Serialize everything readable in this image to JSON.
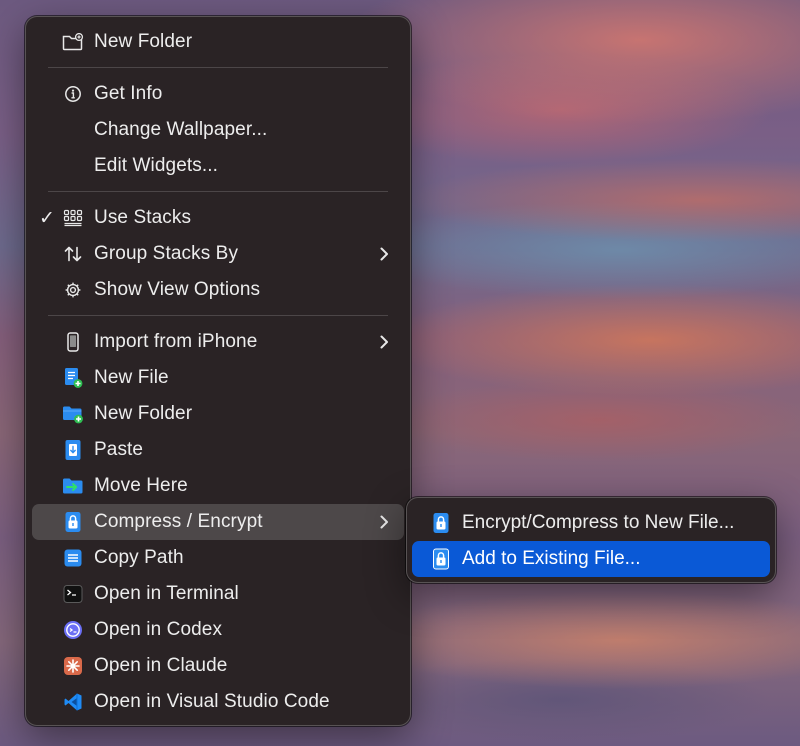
{
  "colors": {
    "menu_bg": "#2a2325",
    "hover_bg": "#4d4849",
    "selected_bg": "#0a59d6",
    "text": "#ededed",
    "icon_blue": "#1f8bf5"
  },
  "menu": {
    "groups": [
      [
        {
          "label": "New Folder",
          "icon": "folder-badge-plus-icon"
        }
      ],
      [
        {
          "label": "Get Info",
          "icon": "info-circle-icon"
        },
        {
          "label": "Change Wallpaper..."
        },
        {
          "label": "Edit Widgets..."
        }
      ],
      [
        {
          "label": "Use Stacks",
          "icon": "stacks-grid-icon",
          "checked": true
        },
        {
          "label": "Group Stacks By",
          "icon": "sort-arrows-icon",
          "submenu": true
        },
        {
          "label": "Show View Options",
          "icon": "gear-icon"
        }
      ],
      [
        {
          "label": "Import from iPhone",
          "icon": "iphone-icon",
          "submenu": true
        },
        {
          "label": "New File",
          "icon": "new-file-icon"
        },
        {
          "label": "New Folder",
          "icon": "new-folder-icon"
        },
        {
          "label": "Paste",
          "icon": "paste-icon"
        },
        {
          "label": "Move Here",
          "icon": "move-here-icon"
        },
        {
          "label": "Compress / Encrypt",
          "icon": "lock-archive-icon",
          "submenu": true,
          "highlighted": true
        },
        {
          "label": "Copy Path",
          "icon": "copy-path-icon"
        },
        {
          "label": "Open in Terminal",
          "icon": "terminal-icon"
        },
        {
          "label": "Open in Codex",
          "icon": "codex-icon"
        },
        {
          "label": "Open in Claude",
          "icon": "claude-icon"
        },
        {
          "label": "Open in Visual Studio Code",
          "icon": "vscode-icon"
        }
      ]
    ]
  },
  "submenu": {
    "items": [
      {
        "label": "Encrypt/Compress to New File...",
        "icon": "lock-archive-icon"
      },
      {
        "label": "Add to Existing File...",
        "icon": "lock-archive-icon",
        "selected": true
      }
    ]
  }
}
